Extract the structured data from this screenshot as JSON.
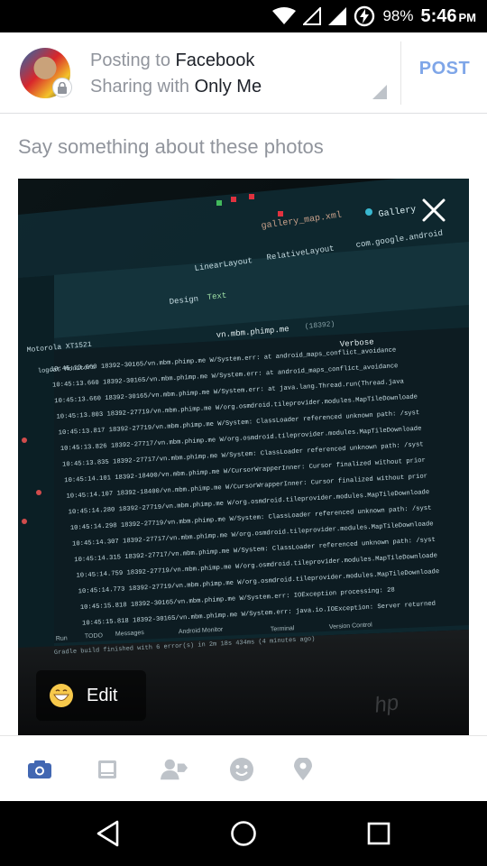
{
  "status_bar": {
    "battery_percent": "98%",
    "time": "5:46",
    "ampm": "PM",
    "icons": [
      "wifi-icon",
      "signal-empty-icon",
      "signal-full-icon",
      "battery-saver-icon"
    ]
  },
  "header": {
    "line1_prefix": "Posting to",
    "line1_target": "Facebook",
    "line2_prefix": "Sharing with",
    "line2_audience": "Only Me",
    "post_label": "POST",
    "accent_color": "#7fa6e8"
  },
  "composer": {
    "placeholder": "Say something about these photos"
  },
  "photo": {
    "edit_label": "Edit",
    "screen_text": {
      "tab_design": "Design",
      "tab_text": "Text",
      "file_tabs": [
        "gallery_map.xml",
        "Gallery"
      ],
      "layouts": [
        "LinearLayout",
        "RelativeLayout",
        "com.google.android"
      ],
      "package_filter": "vn.mbm.phimp.me",
      "pid": "(18392)",
      "log_level": "Verbose",
      "device": "Motorola XT1521",
      "logcat": "logcat",
      "monitors": "Monitors",
      "bottom_tabs": [
        "Run",
        "TODO",
        "Messages",
        "Android Monitor",
        "Terminal",
        "Version Control"
      ],
      "build_status": "Gradle build finished with 6 error(s) in 2m 18s 434ms (4 minutes ago)",
      "logo": "hp",
      "log_lines": [
        "10:45:13.660 18392-30165/vn.mbm.phimp.me W/System.err:     at android_maps_conflict_avoidance",
        "10:45:13.660 18392-30165/vn.mbm.phimp.me W/System.err:     at android_maps_conflict_avoidance",
        "10:45:13.660 18392-30165/vn.mbm.phimp.me W/System.err:     at java.lang.Thread.run(Thread.java",
        "10:45:13.803 18392-27719/vn.mbm.phimp.me W/org.osmdroid.tileprovider.modules.MapTileDownloade",
        "10:45:13.817 18392-27719/vn.mbm.phimp.me W/System: ClassLoader referenced unknown path: /syst",
        "10:45:13.826 18392-27717/vn.mbm.phimp.me W/org.osmdroid.tileprovider.modules.MapTileDownloade",
        "10:45:13.835 18392-27717/vn.mbm.phimp.me W/System: ClassLoader referenced unknown path: /syst",
        "10:45:14.101 18392-18400/vn.mbm.phimp.me W/CursorWrapperInner: Cursor finalized without prior",
        "10:45:14.107 18392-18400/vn.mbm.phimp.me W/CursorWrapperInner: Cursor finalized without prior",
        "10:45:14.280 18392-27719/vn.mbm.phimp.me W/org.osmdroid.tileprovider.modules.MapTileDownloade",
        "10:45:14.298 18392-27719/vn.mbm.phimp.me W/System: ClassLoader referenced unknown path: /syst",
        "10:45:14.307 18392-27717/vn.mbm.phimp.me W/org.osmdroid.tileprovider.modules.MapTileDownloade",
        "10:45:14.315 18392-27717/vn.mbm.phimp.me W/System: ClassLoader referenced unknown path: /syst",
        "10:45:14.759 18392-27719/vn.mbm.phimp.me W/org.osmdroid.tileprovider.modules.MapTileDownloade",
        "10:45:14.773 18392-27719/vn.mbm.phimp.me W/org.osmdroid.tileprovider.modules.MapTileDownloade",
        "10:45:15.818 18392-30165/vn.mbm.phimp.me W/System.err: IOException processing: 28",
        "10:45:15.818 18392-30165/vn.mbm.phimp.me W/System.err: java.io.IOException: Server returned"
      ]
    }
  },
  "toolbar": {
    "items": [
      "camera-icon",
      "album-icon",
      "tag-people-icon",
      "feeling-icon",
      "location-icon"
    ],
    "active_color": "#4267b2",
    "inactive_color": "#bec3c9"
  },
  "nav_bar": {
    "items": [
      "back-icon",
      "home-icon",
      "recents-icon"
    ]
  }
}
